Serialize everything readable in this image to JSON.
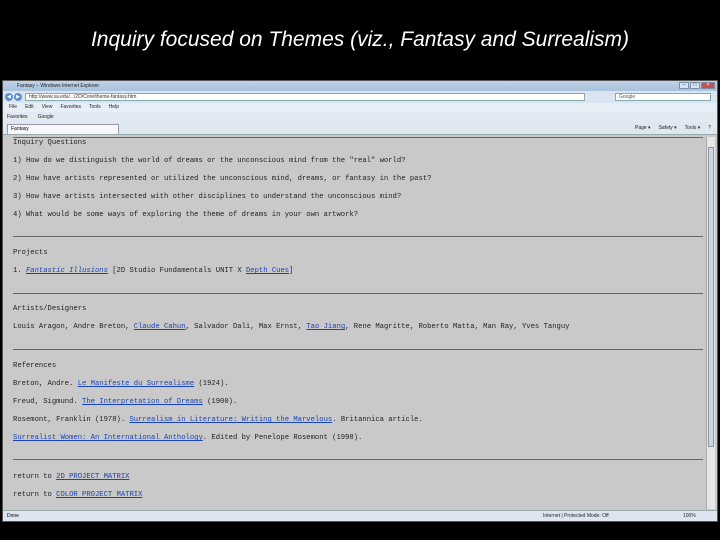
{
  "slide": {
    "title": "Inquiry focused on Themes (viz., Fantasy and Surrealism)"
  },
  "browser": {
    "window_title": "Fantasy – Windows Internet Explorer",
    "address": "http://www.sa.edu/.../2D/Core/theme-fantasy.htm",
    "search_placeholder": "Google",
    "menu": [
      "File",
      "Edit",
      "View",
      "Favorites",
      "Tools",
      "Help"
    ],
    "favorites_label": "Favorites",
    "fav_items": [
      "",
      "Google"
    ],
    "tab_label": "Fantasy",
    "commands": [
      "Page ▾",
      "Safety ▾",
      "Tools ▾",
      "?"
    ],
    "status_done": "Done",
    "status_zone": "Internet | Protected Mode: Off",
    "status_zoom": "100%"
  },
  "page": {
    "inquiry": {
      "heading": "Inquiry Questions",
      "questions": [
        "1) How do we distinguish the world of dreams or the unconscious mind from the \"real\" world?",
        "2) How have artists represented or utilized the unconscious mind, dreams, or fantasy in the past?",
        "3) How have artists intersected with other disciplines to understand the unconscious mind?",
        "4) What would be some ways of exploring the theme of dreams in your own artwork?"
      ]
    },
    "projects": {
      "heading": "Projects",
      "num": "1.",
      "link": "Fantastic Illusions",
      "mid": " [2D Studio Fundamentals   UNIT X  ",
      "link2": "Depth Cues",
      "end": "]"
    },
    "artists": {
      "heading": "Artists/Designers",
      "a1": "Louis Aragon, Andre Breton, ",
      "l1": "Claude Cahun",
      "a2": ", Salvador Dali, Max Ernst, ",
      "l2": "Tao Jiang",
      "a3": ", Rene Magritte, Roberto Matta, Man Ray, Yves Tanguy"
    },
    "references": {
      "heading": "References",
      "r1a": "Breton, Andre. ",
      "r1l": "Le Manifeste du Surrealisme",
      "r1b": " (1924).",
      "r2a": "Freud, Sigmund. ",
      "r2l": "The Interpretation of Dreams",
      "r2b": " (1900).",
      "r3a": "Rosemont, Franklin (1978). ",
      "r3l": "Surrealism in Literature: Writing the Marvelous",
      "r3b": ". Britannica article.",
      "r4l": "Surrealist Women: An International Anthology",
      "r4b": ". Edited by Penelope Rosemont (1998)."
    },
    "returns": {
      "prefix": "return to ",
      "link1": "2D PROJECT MATRIX",
      "link2": "COLOR PROJECT MATRIX"
    }
  }
}
